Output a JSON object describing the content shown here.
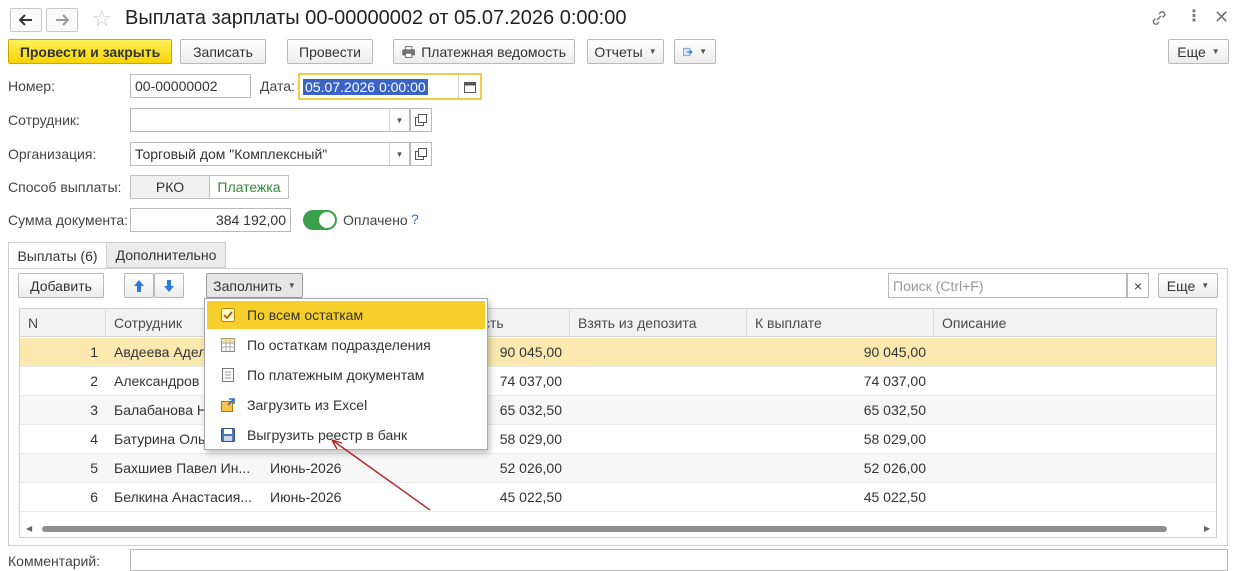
{
  "window": {
    "title": "Выплата зарплаты 00-00000002 от 05.07.2026 0:00:00"
  },
  "toolbar": {
    "post_close": "Провести и закрыть",
    "write": "Записать",
    "post": "Провести",
    "payment_sheet": "Платежная ведомость",
    "reports": "Отчеты",
    "more": "Еще"
  },
  "form": {
    "number_label": "Номер:",
    "number_value": "00-00000002",
    "date_label": "Дата:",
    "date_value": "05.07.2026  0:00:00",
    "employee_label": "Сотрудник:",
    "employee_value": "",
    "org_label": "Организация:",
    "org_value": "Торговый дом \"Комплексный\"",
    "pay_method_label": "Способ выплаты:",
    "pay_method_options": [
      "РКО",
      "Платежка"
    ],
    "sum_label": "Сумма документа:",
    "sum_value": "384 192,00",
    "paid_label": "Оплачено",
    "paid_help": "?",
    "comment_label": "Комментарий:"
  },
  "tabs": [
    {
      "label": "Выплаты (6)"
    },
    {
      "label": "Дополнительно"
    }
  ],
  "table_toolbar": {
    "add": "Добавить",
    "fill": "Заполнить",
    "search_placeholder": "Поиск (Ctrl+F)",
    "clear": "×",
    "more": "Еще"
  },
  "fill_menu": {
    "items": [
      {
        "label": "По всем остаткам",
        "icon": "balances-icon"
      },
      {
        "label": "По остаткам подразделения",
        "icon": "grid-icon"
      },
      {
        "label": "По платежным документам",
        "icon": "document-icon"
      },
      {
        "label": "Загрузить из Excel",
        "icon": "excel-import-icon"
      },
      {
        "label": "Выгрузить реестр в банк",
        "icon": "floppy-save-icon"
      }
    ]
  },
  "table": {
    "columns": [
      "N",
      "Сотрудник",
      "",
      "сть",
      "Взять из депозита",
      "К выплате",
      "Описание"
    ],
    "rows": [
      {
        "n": "1",
        "employee": "Авдеева Адел",
        "period": "",
        "amount": "90 045,00",
        "deposit": "",
        "to_pay": "90 045,00"
      },
      {
        "n": "2",
        "employee": "Александров П",
        "period": "",
        "amount": "74 037,00",
        "deposit": "",
        "to_pay": "74 037,00"
      },
      {
        "n": "3",
        "employee": "Балабанова На",
        "period": "",
        "amount": "65 032,50",
        "deposit": "",
        "to_pay": "65 032,50"
      },
      {
        "n": "4",
        "employee": "Батурина Ольг",
        "period": "",
        "amount": "58 029,00",
        "deposit": "",
        "to_pay": "58 029,00"
      },
      {
        "n": "5",
        "employee": "Бахшиев Павел Ин...",
        "period": "Июнь-2026",
        "amount": "52 026,00",
        "deposit": "",
        "to_pay": "52 026,00"
      },
      {
        "n": "6",
        "employee": "Белкина Анастасия...",
        "period": "Июнь-2026",
        "amount": "45 022,50",
        "deposit": "",
        "to_pay": "45 022,50"
      }
    ]
  },
  "colors": {
    "primary_button": "#f6d400",
    "selected_row": "#fbe9b0",
    "menu_active": "#f6cf2a",
    "toggle": "#3aa14a",
    "link_green": "#2f8a3a",
    "help_blue": "#2a6fd1"
  }
}
